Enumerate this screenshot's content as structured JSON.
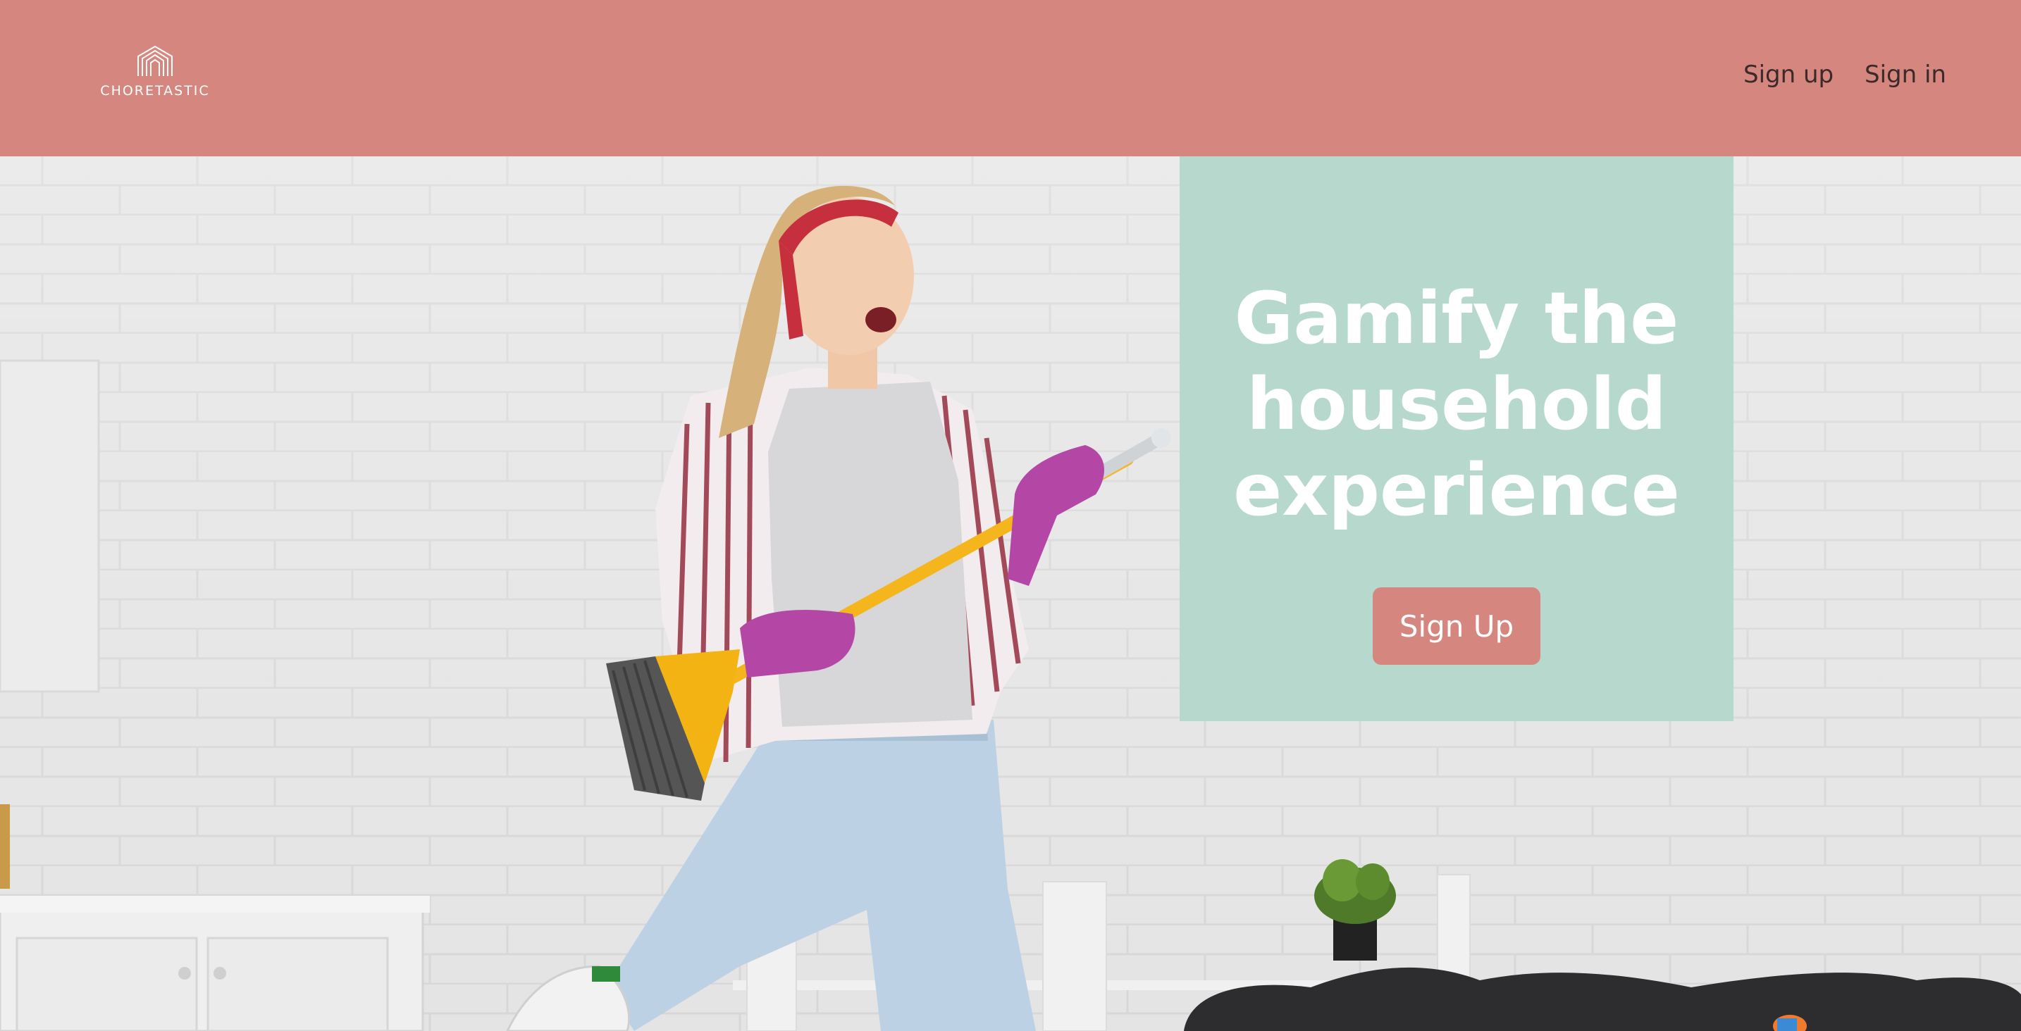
{
  "brand": {
    "name": "CHORETASTIC",
    "logo_icon": "house-lines-icon"
  },
  "nav": {
    "sign_up_label": "Sign up",
    "sign_in_label": "Sign in"
  },
  "hero": {
    "headline_line1": "Gamify the",
    "headline_line2": "household",
    "headline_line3": "experience",
    "cta_label": "Sign Up",
    "background_image": "woman-with-broom-photo"
  },
  "colors": {
    "header_bg": "#d5877f",
    "panel_bg": "#b7d8cc",
    "button_bg": "#d5877f",
    "nav_text": "#3b2a2a",
    "hero_text": "#ffffff"
  }
}
